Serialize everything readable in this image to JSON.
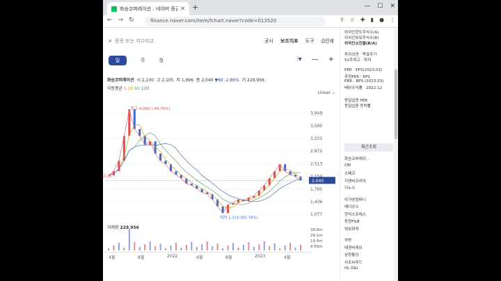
{
  "browser": {
    "tab_title": "화승코퍼레이션 : 네이버 증권",
    "url": "finance.naver.com/item/fchart.naver?code=013520"
  },
  "chart_header": {
    "search_placeholder": "종목 또는 지수비교",
    "menu": [
      "공시",
      "보조지표",
      "도구",
      "인쇄"
    ],
    "periods": [
      "일",
      "주",
      "월"
    ],
    "name": "화승코퍼레이션",
    "open_label": "시",
    "open": "2,100",
    "high_label": "고",
    "high": "2,105",
    "low_label": "저",
    "low": "1,996",
    "close_label": "종",
    "close": "2,040",
    "change": "▼60",
    "change_pct": "-2.86%",
    "volume_label": "거",
    "volume": "229,956",
    "ma_label": "이동평균",
    "ma": [
      "5",
      "20",
      "60",
      "120"
    ],
    "scale": "Linear"
  },
  "chart_data": {
    "type": "line",
    "x": [
      "4월",
      "8월",
      "2022",
      "4월",
      "8월",
      "2023",
      "4월"
    ],
    "y_ticks": [
      "3,949",
      "3,590",
      "3,231",
      "2,872",
      "2,513",
      "2,154",
      "1,795",
      "1,436",
      "1,077"
    ],
    "ylim": [
      1000,
      4200
    ],
    "current": "2,040",
    "high_annotation": "최고 4,060 (-49.75%)",
    "low_annotation": "최저 1,110 (83.78%)",
    "left_marker": "2,18",
    "series": [
      {
        "values": [
          2180,
          2300,
          2600,
          3300,
          4060,
          3500,
          3300,
          3050,
          3150,
          2800,
          2600,
          2500,
          2300,
          2200,
          2100,
          1950,
          1900,
          1800,
          1700,
          1650,
          1500,
          1300,
          1110,
          1350,
          1400,
          1500,
          1450,
          1550,
          1600,
          1750,
          1900,
          2100,
          2300,
          2500,
          2300,
          2200,
          2150,
          2040
        ]
      }
    ],
    "volume": {
      "header_label": "거래량",
      "header_value": "229,956",
      "ticks": [
        "38.8m",
        "29.1m",
        "19.4m",
        "9.69m"
      ]
    }
  },
  "sidebar": {
    "items": [
      "외국인한도주식수(A)",
      "외국인보유주식수(B)",
      "외국인소진율(B/A)",
      "투자의견 · 목표주가",
      "52주최고 · 최저",
      "PER · EPS(2023.03)",
      "추정PER · EPS",
      "PBR · BPS (2023.03)",
      "배당수익률 · 2022.12",
      "동일업종 PER",
      "동일업종 등락률"
    ],
    "recent_header": "최근조회",
    "recent": [
      "화승코퍼레이...",
      "CBI",
      "스페코",
      "지엠비코리아",
      "지누스",
      "아가방컴퍼니",
      "메디앙스",
      "한익스프레스",
      "동원F&B",
      "영보화학",
      "부방",
      "태경비케이",
      "삼양통상",
      "사조씨푸드",
      "HL D&I"
    ]
  }
}
